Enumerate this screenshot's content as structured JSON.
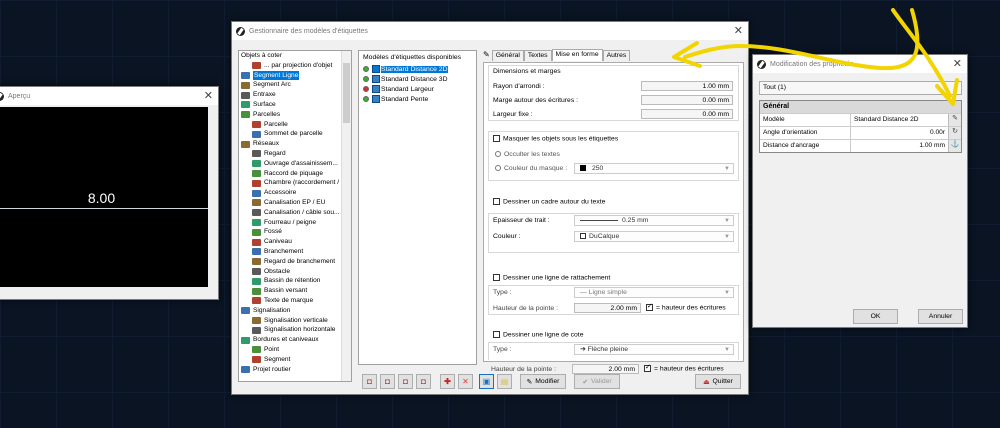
{
  "preview": {
    "title": "Aperçu",
    "value": "8.00"
  },
  "manager": {
    "title": "Gestionnaire des modèles d'étiquettes",
    "tree": [
      {
        "label": "Objets à coter",
        "indent": 0,
        "icon": "none"
      },
      {
        "label": "... par projection d'objet",
        "indent": 1,
        "icon": "projection-icon"
      },
      {
        "label": "Segment Ligne",
        "indent": 0,
        "icon": "line-icon",
        "selected": true
      },
      {
        "label": "Segment Arc",
        "indent": 0,
        "icon": "arc-icon"
      },
      {
        "label": "Entraxe",
        "indent": 0,
        "icon": "centre-icon"
      },
      {
        "label": "Surface",
        "indent": 0,
        "icon": "surface-icon"
      },
      {
        "label": "Parcelles",
        "indent": 0,
        "icon": "parcel-icon"
      },
      {
        "label": "Parcelle",
        "indent": 1,
        "icon": "parcel-icon"
      },
      {
        "label": "Sommet de parcelle",
        "indent": 1,
        "icon": "vertex-icon"
      },
      {
        "label": "Réseaux",
        "indent": 0,
        "icon": "network-icon"
      },
      {
        "label": "Regard",
        "indent": 1,
        "icon": "manhole-icon"
      },
      {
        "label": "Ouvrage d'assainissem...",
        "indent": 1,
        "icon": "sewer-icon"
      },
      {
        "label": "Raccord de piquage",
        "indent": 1,
        "icon": "fitting-icon"
      },
      {
        "label": "Chambre (raccordement / t",
        "indent": 1,
        "icon": "chamber-icon"
      },
      {
        "label": "Accessoire",
        "indent": 1,
        "icon": "accessory-icon"
      },
      {
        "label": "Canalisation EP / EU",
        "indent": 1,
        "icon": "pipe-icon"
      },
      {
        "label": "Canalisation / câble sou...",
        "indent": 1,
        "icon": "cable-icon"
      },
      {
        "label": "Fourreau / peigne",
        "indent": 1,
        "icon": "sheath-icon"
      },
      {
        "label": "Fossé",
        "indent": 1,
        "icon": "ditch-icon"
      },
      {
        "label": "Caniveau",
        "indent": 1,
        "icon": "gutter-icon"
      },
      {
        "label": "Branchement",
        "indent": 1,
        "icon": "branch-icon"
      },
      {
        "label": "Regard de branchement",
        "indent": 1,
        "icon": "manhole-icon"
      },
      {
        "label": "Obstacle",
        "indent": 1,
        "icon": "obstacle-icon"
      },
      {
        "label": "Bassin de rétention",
        "indent": 1,
        "icon": "basin-icon"
      },
      {
        "label": "Bassin versant",
        "indent": 1,
        "icon": "basin-icon"
      },
      {
        "label": "Texte de marque",
        "indent": 1,
        "icon": "text-icon"
      },
      {
        "label": "Signalisation",
        "indent": 0,
        "icon": "sign-icon"
      },
      {
        "label": "Signalisation verticale",
        "indent": 1,
        "icon": "sign-icon"
      },
      {
        "label": "Signalisation horizontale",
        "indent": 1,
        "icon": "marking-icon"
      },
      {
        "label": "Bordures et caniveaux",
        "indent": 0,
        "icon": "kerb-icon"
      },
      {
        "label": "Point",
        "indent": 1,
        "icon": "point-icon"
      },
      {
        "label": "Segment",
        "indent": 1,
        "icon": "segment-icon"
      },
      {
        "label": "Projet routier",
        "indent": 0,
        "icon": "road-icon"
      }
    ],
    "models_header": "Modèles d'étiquettes disponibles",
    "models": [
      {
        "label": "Standard Distance 2D",
        "color": "#38b030",
        "selected": true
      },
      {
        "label": "Standard Distance 3D",
        "color": "#38b030"
      },
      {
        "label": "Standard Largeur",
        "color": "#d23030"
      },
      {
        "label": "Standard Pente",
        "color": "#38b030"
      }
    ],
    "tabs": [
      "Général",
      "Textes",
      "Mise en forme",
      "Autres"
    ],
    "active_tab": "Mise en forme",
    "dims": {
      "title": "Dimensions et marges",
      "rayon_label": "Rayon d'arrondi :",
      "rayon": "1.00 mm",
      "marge_label": "Marge autour des écritures :",
      "marge": "0.00 mm",
      "largeur_label": "Largeur fixe :",
      "largeur": "0.00 mm"
    },
    "mask": {
      "check": "Masquer les objets sous les étiquettes",
      "occulter": "Occulter les textes",
      "couleur_label": "Couleur du masque :",
      "couleur": "250"
    },
    "frame": {
      "check": "Dessiner un cadre autour du texte",
      "epaisseur_label": "Epaisseur de trait :",
      "epaisseur": "0.25 mm",
      "couleur_label": "Couleur :",
      "couleur": "DuCalque"
    },
    "attach": {
      "check": "Dessiner une ligne de rattachement",
      "type_label": "Type :",
      "type": "Ligne simple",
      "hauteur_label": "Hauteur de la pointe :",
      "hauteur": "2.00 mm",
      "eq": "= hauteur des écritures"
    },
    "cote": {
      "check": "Dessiner une ligne de cote",
      "type_label": "Type :",
      "type": "Flèche pleine",
      "hauteur_label": "Hauteur de la pointe :",
      "hauteur": "2.00 mm",
      "eq": "= hauteur des écritures"
    },
    "buttons": {
      "modifier": "Modifier",
      "valider": "Valider",
      "quitter": "Quitter"
    }
  },
  "props": {
    "title": "Modification des propriétés",
    "tab": "Tout (1)",
    "section": "Général",
    "rows": [
      {
        "key": "Modèle",
        "value": "Standard Distance 2D",
        "align": "left",
        "icon": "edit-icon"
      },
      {
        "key": "Angle d'orientation",
        "value": "0.00r",
        "align": "right",
        "icon": "refresh-icon"
      },
      {
        "key": "Distance d'ancrage",
        "value": "1.00 mm",
        "align": "right",
        "icon": "anchor-icon"
      }
    ],
    "ok": "OK",
    "cancel": "Annuler"
  },
  "annotation_color": "#f2d400"
}
